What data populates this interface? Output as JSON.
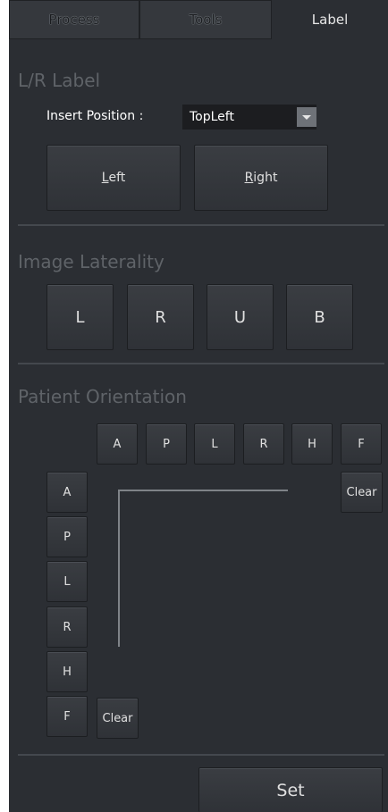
{
  "tabs": [
    {
      "label": "Process"
    },
    {
      "label": "Tools"
    },
    {
      "label": "Label"
    }
  ],
  "lr_label": {
    "title": "L/R Label",
    "insert_position_label": "Insert Position :",
    "insert_position_value": "TopLeft",
    "left_button": {
      "accel": "L",
      "rest": "eft"
    },
    "right_button": {
      "accel": "R",
      "rest": "ight"
    }
  },
  "image_laterality": {
    "title": "Image Laterality",
    "buttons": [
      "L",
      "R",
      "U",
      "B"
    ]
  },
  "patient_orientation": {
    "title": "Patient Orientation",
    "top_buttons": [
      "A",
      "P",
      "L",
      "R",
      "H",
      "F"
    ],
    "side_buttons": [
      "A",
      "P",
      "L",
      "R",
      "H",
      "F"
    ],
    "clear_top": "Clear",
    "clear_side": "Clear"
  },
  "set_button": "Set",
  "colors": {
    "panel_bg": "#2b2e33",
    "button_bg": "#35383d",
    "section_title": "#5f6368",
    "text": "#e0e0e0"
  }
}
